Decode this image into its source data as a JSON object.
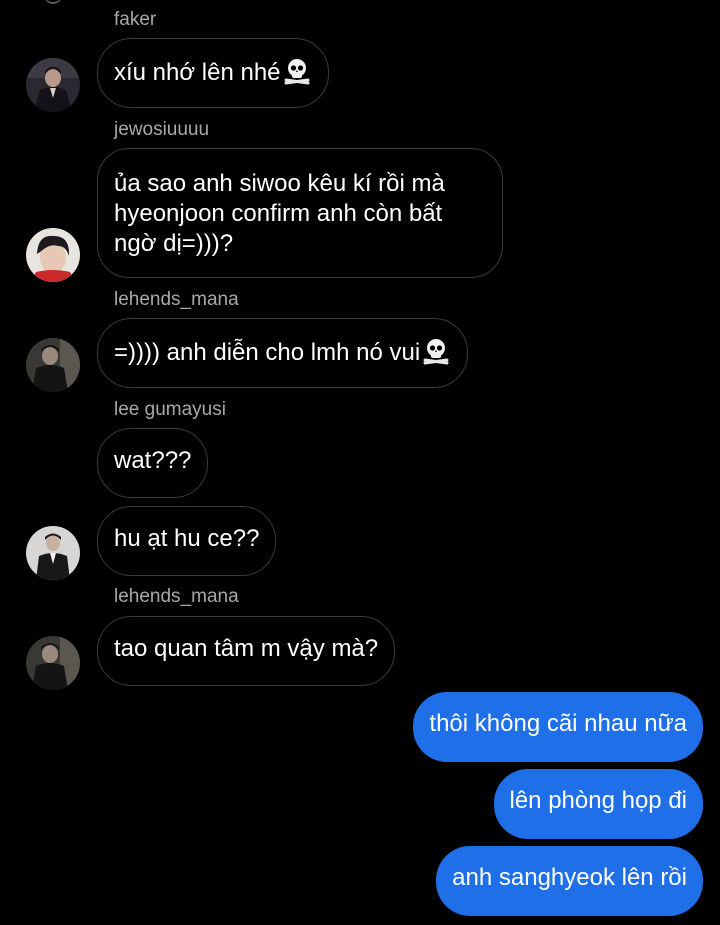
{
  "messages": [
    {
      "sender": "faker",
      "text": "xíu nhớ lên nhé",
      "emoji": "skull-crossbones-icon"
    },
    {
      "sender": "jewosiuuuu",
      "text": "ủa sao anh siwoo kêu kí rồi mà hyeonjoon confirm anh còn bất ngờ dị=)))?"
    },
    {
      "sender": "lehends_mana",
      "text": "=)))) anh diễn cho lmh nó vui",
      "emoji": "skull-crossbones-icon"
    },
    {
      "sender": "lee gumayusi",
      "text": "wat???"
    },
    {
      "sender": "",
      "text": "hu ạt hu ce??"
    },
    {
      "sender": "lehends_mana",
      "text": "tao quan tâm m vậy mà?"
    }
  ],
  "outgoing": [
    {
      "text": "thôi không cãi nhau nữa"
    },
    {
      "text": "lên phòng họp đi"
    },
    {
      "text": "anh sanghyeok lên rồi"
    }
  ],
  "colors": {
    "background": "#000000",
    "incoming_border": "#3a3a3a",
    "outgoing_bubble": "#1f6fe8",
    "sender_name": "#a8a8a8",
    "text": "#ffffff"
  }
}
